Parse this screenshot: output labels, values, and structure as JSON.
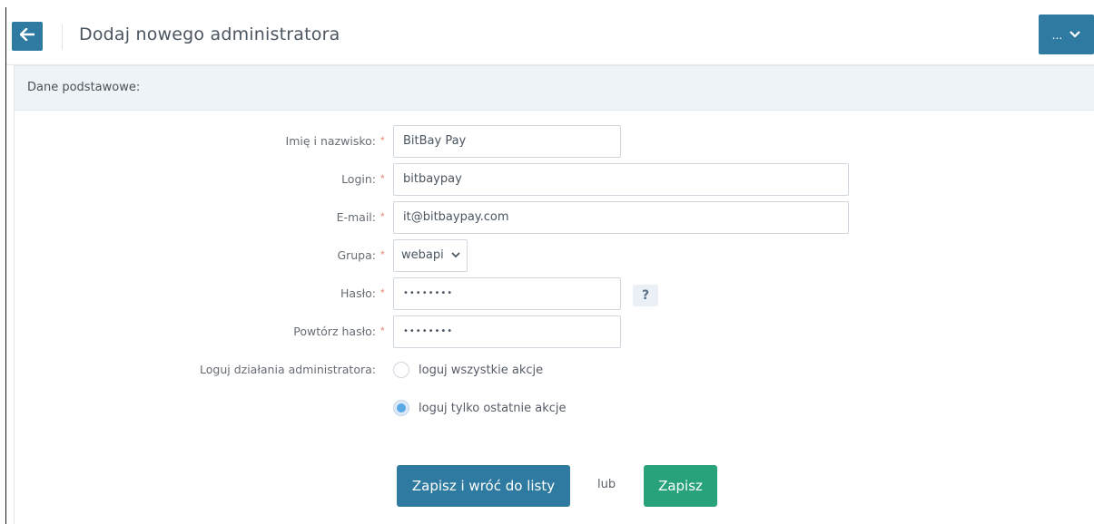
{
  "header": {
    "title": "Dodaj nowego administratora",
    "back_icon": "arrow-left-icon",
    "more_label": "...",
    "more_icon": "chevron-down-icon",
    "accent_color": "#2e7aa0"
  },
  "section": {
    "title": "Dane podstawowe:"
  },
  "form": {
    "required_mark": "*",
    "name": {
      "label": "Imię i nazwisko:",
      "value": "BitBay Pay"
    },
    "login": {
      "label": "Login:",
      "value": "bitbaypay"
    },
    "email": {
      "label": "E-mail:",
      "value": "it@bitbaypay.com"
    },
    "group": {
      "label": "Grupa:",
      "selected": "webapi"
    },
    "password": {
      "label": "Hasło:",
      "value": "••••••••",
      "help": "?"
    },
    "password_repeat": {
      "label": "Powtórz hasło:",
      "value": "••••••••"
    },
    "logging": {
      "label": "Loguj działania administratora:",
      "options": [
        {
          "label": "loguj wszystkie akcje",
          "checked": false
        },
        {
          "label": "loguj tylko ostatnie akcje",
          "checked": true
        }
      ]
    }
  },
  "actions": {
    "save_and_back": "Zapisz i wróć do listy",
    "or": "lub",
    "save": "Zapisz",
    "success_color": "#27a27b"
  }
}
